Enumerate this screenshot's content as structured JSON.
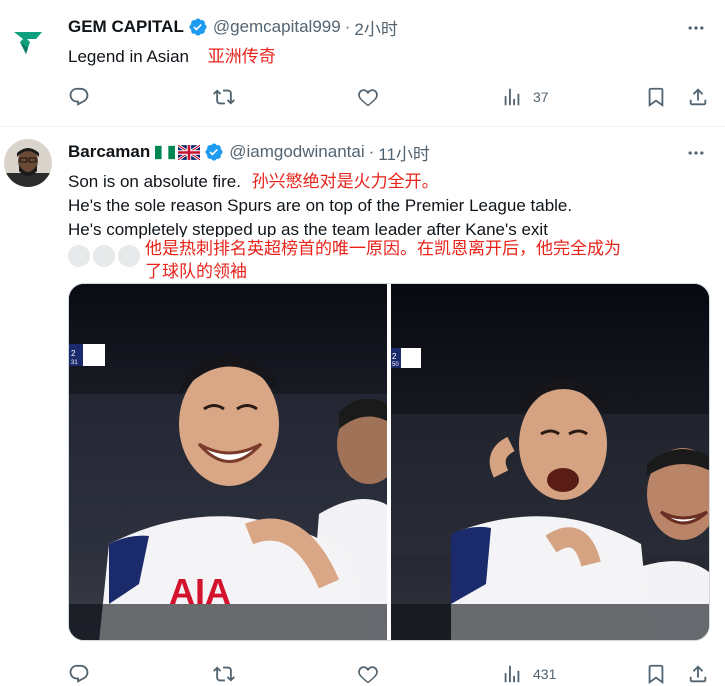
{
  "tweets": [
    {
      "name": "GEM CAPITAL",
      "handle": "@gemcapital999",
      "separator": "·",
      "time": "2小时",
      "lines": [
        {
          "text": "Legend in Asian",
          "annotation": "亚洲传奇"
        }
      ],
      "actions": {
        "reply": "",
        "retweet": "",
        "like": "",
        "views": "37"
      }
    },
    {
      "name": "Barcaman",
      "handle": "@iamgodwinantai",
      "separator": "·",
      "time": "11小时",
      "lines": [
        {
          "text": "Son is on absolute fire.",
          "annotation": "孙兴慜绝对是火力全开。"
        },
        {
          "text": "He's the sole reason Spurs are on top of the Premier League table.",
          "annotation": ""
        },
        {
          "text": "He's completely stepped up as the team leader after Kane's exit",
          "annotation": ""
        }
      ],
      "overlay_annotation_line1": "他是热刺排名英超榜首的唯一原因。在凯恩离开后，他完全成为",
      "overlay_annotation_line2": "了球队的领袖",
      "media_left_score": "2",
      "media_left_score2": "31",
      "media_right_score": "2",
      "media_right_score2": "50",
      "shirt_text": "AIA",
      "actions": {
        "reply": "",
        "retweet": "",
        "like": "",
        "views": "431"
      }
    }
  ],
  "colors": {
    "verified": "#1d9bf0",
    "annotation": "#e8231a",
    "muted": "#536471",
    "brand": "#0fa080"
  },
  "icons": [
    "gem-logo-icon",
    "verified-badge-icon",
    "more-icon",
    "reply-icon",
    "retweet-icon",
    "like-icon",
    "views-icon",
    "bookmark-icon",
    "share-icon",
    "nigeria-flag-icon",
    "uk-flag-icon"
  ]
}
